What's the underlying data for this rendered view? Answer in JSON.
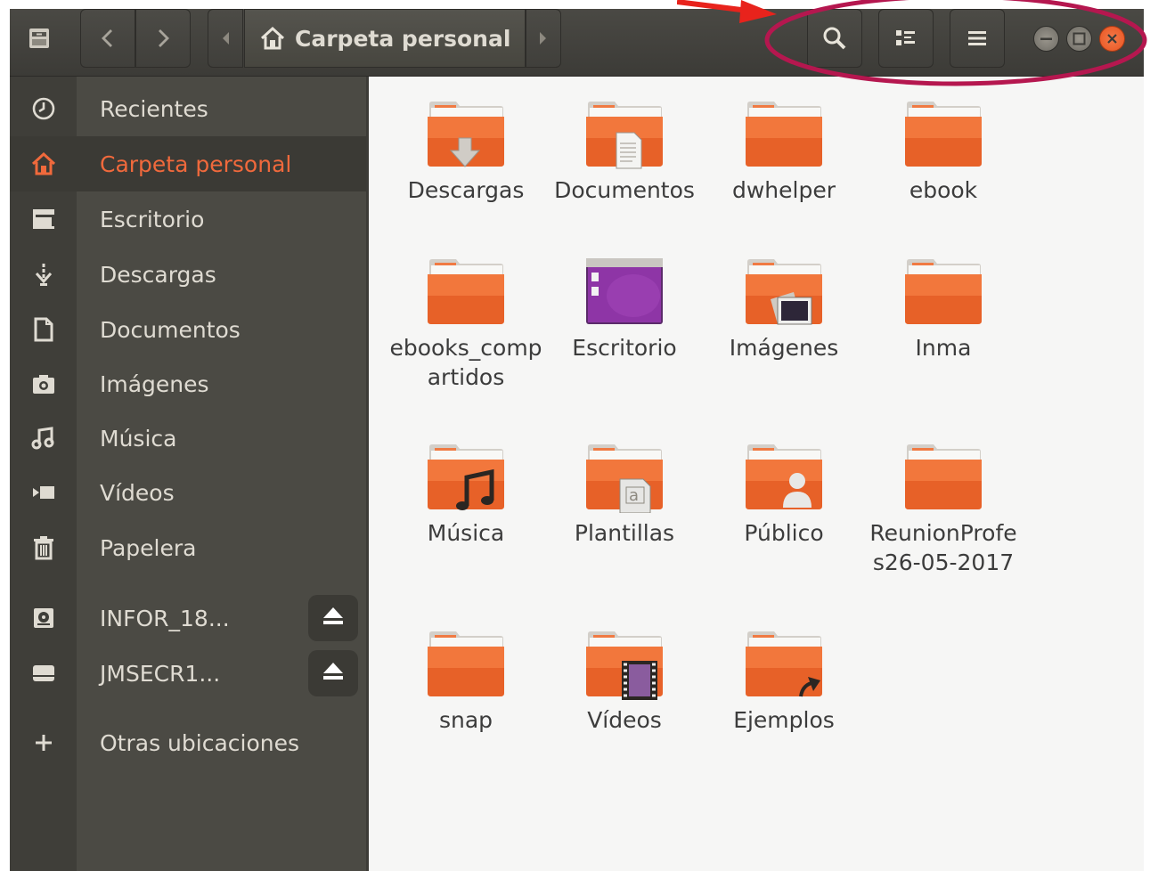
{
  "headerbar": {
    "breadcrumb_current": "Carpeta personal",
    "back_icon": "chevron-left-icon",
    "forward_icon": "chevron-right-icon",
    "search_icon": "search-icon",
    "view_icon": "list-view-icon",
    "menu_icon": "hamburger-menu-icon"
  },
  "sidebar": {
    "items": [
      {
        "label": "Recientes",
        "icon": "clock-icon"
      },
      {
        "label": "Carpeta personal",
        "icon": "home-icon"
      },
      {
        "label": "Escritorio",
        "icon": "desktop-folder-icon"
      },
      {
        "label": "Descargas",
        "icon": "download-icon"
      },
      {
        "label": "Documentos",
        "icon": "document-icon"
      },
      {
        "label": "Imágenes",
        "icon": "camera-icon"
      },
      {
        "label": "Música",
        "icon": "music-icon"
      },
      {
        "label": "Vídeos",
        "icon": "video-icon"
      },
      {
        "label": "Papelera",
        "icon": "trash-icon"
      }
    ],
    "devices": [
      {
        "label": "INFOR_18...",
        "icon": "drive-icon"
      },
      {
        "label": "JMSECR1...",
        "icon": "removable-drive-icon"
      }
    ],
    "other_locations": "Otras ubicaciones"
  },
  "folders": [
    {
      "label": "Descargas",
      "emblem": "download"
    },
    {
      "label": "Documentos",
      "emblem": "document"
    },
    {
      "label": "dwhelper",
      "emblem": "none"
    },
    {
      "label": "ebook",
      "emblem": "none"
    },
    {
      "label": "ebooks_compartidos",
      "emblem": "none"
    },
    {
      "label": "Escritorio",
      "emblem": "desktop"
    },
    {
      "label": "Imágenes",
      "emblem": "pictures"
    },
    {
      "label": "Inma",
      "emblem": "none"
    },
    {
      "label": "Música",
      "emblem": "music"
    },
    {
      "label": "Plantillas",
      "emblem": "templates"
    },
    {
      "label": "Público",
      "emblem": "public"
    },
    {
      "label": "ReunionProfes26-05-2017",
      "emblem": "none"
    },
    {
      "label": "snap",
      "emblem": "none"
    },
    {
      "label": "Vídeos",
      "emblem": "videos"
    },
    {
      "label": "Ejemplos",
      "emblem": "link"
    }
  ],
  "colors": {
    "accent": "#f0693c",
    "headerbar": "#3c3b37",
    "sidebar": "#4b4a44",
    "content": "#f6f6f5",
    "close_button": "#e95420",
    "annotation": "#b5174f"
  }
}
